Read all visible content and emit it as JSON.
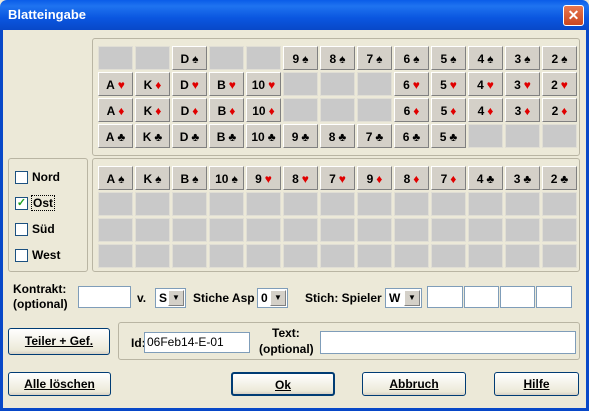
{
  "window": {
    "title": "Blatteingabe",
    "close": "✕"
  },
  "top_grid": [
    [
      null,
      null,
      {
        "r": "D",
        "s": "♠",
        "c": "black"
      },
      null,
      null,
      {
        "r": "9",
        "s": "♠",
        "c": "black"
      },
      {
        "r": "8",
        "s": "♠",
        "c": "black"
      },
      {
        "r": "7",
        "s": "♠",
        "c": "black"
      },
      {
        "r": "6",
        "s": "♠",
        "c": "black"
      },
      {
        "r": "5",
        "s": "♠",
        "c": "black"
      },
      {
        "r": "4",
        "s": "♠",
        "c": "black"
      },
      {
        "r": "3",
        "s": "♠",
        "c": "black"
      },
      {
        "r": "2",
        "s": "♠",
        "c": "black"
      }
    ],
    [
      {
        "r": "A",
        "s": "♥",
        "c": "red"
      },
      {
        "r": "K",
        "s": "♦",
        "c": "red"
      },
      {
        "r": "D",
        "s": "♥",
        "c": "red"
      },
      {
        "r": "B",
        "s": "♥",
        "c": "red"
      },
      {
        "r": "10",
        "s": "♥",
        "c": "red"
      },
      null,
      null,
      null,
      {
        "r": "6",
        "s": "♥",
        "c": "red"
      },
      {
        "r": "5",
        "s": "♥",
        "c": "red"
      },
      {
        "r": "4",
        "s": "♥",
        "c": "red"
      },
      {
        "r": "3",
        "s": "♥",
        "c": "red"
      },
      {
        "r": "2",
        "s": "♥",
        "c": "red"
      }
    ],
    [
      {
        "r": "A",
        "s": "♦",
        "c": "red"
      },
      {
        "r": "K",
        "s": "♦",
        "c": "red"
      },
      {
        "r": "D",
        "s": "♦",
        "c": "red"
      },
      {
        "r": "B",
        "s": "♦",
        "c": "red"
      },
      {
        "r": "10",
        "s": "♦",
        "c": "red"
      },
      null,
      null,
      null,
      {
        "r": "6",
        "s": "♦",
        "c": "red"
      },
      {
        "r": "5",
        "s": "♦",
        "c": "red"
      },
      {
        "r": "4",
        "s": "♦",
        "c": "red"
      },
      {
        "r": "3",
        "s": "♦",
        "c": "red"
      },
      {
        "r": "2",
        "s": "♦",
        "c": "red"
      }
    ],
    [
      {
        "r": "A",
        "s": "♣",
        "c": "black"
      },
      {
        "r": "K",
        "s": "♣",
        "c": "black"
      },
      {
        "r": "D",
        "s": "♣",
        "c": "black"
      },
      {
        "r": "B",
        "s": "♣",
        "c": "black"
      },
      {
        "r": "10",
        "s": "♣",
        "c": "black"
      },
      {
        "r": "9",
        "s": "♣",
        "c": "black"
      },
      {
        "r": "8",
        "s": "♣",
        "c": "black"
      },
      {
        "r": "7",
        "s": "♣",
        "c": "black"
      },
      {
        "r": "6",
        "s": "♣",
        "c": "black"
      },
      {
        "r": "5",
        "s": "♣",
        "c": "black"
      },
      null,
      null,
      null
    ]
  ],
  "bottom_grid": [
    [
      {
        "r": "A",
        "s": "♠",
        "c": "black"
      },
      {
        "r": "K",
        "s": "♠",
        "c": "black"
      },
      {
        "r": "B",
        "s": "♠",
        "c": "black"
      },
      {
        "r": "10",
        "s": "♠",
        "c": "black"
      },
      {
        "r": "9",
        "s": "♥",
        "c": "red"
      },
      {
        "r": "8",
        "s": "♥",
        "c": "red"
      },
      {
        "r": "7",
        "s": "♥",
        "c": "red"
      },
      {
        "r": "9",
        "s": "♦",
        "c": "red"
      },
      {
        "r": "8",
        "s": "♦",
        "c": "red"
      },
      {
        "r": "7",
        "s": "♦",
        "c": "red"
      },
      {
        "r": "4",
        "s": "♣",
        "c": "black"
      },
      {
        "r": "3",
        "s": "♣",
        "c": "black"
      },
      {
        "r": "2",
        "s": "♣",
        "c": "black"
      }
    ],
    [
      null,
      null,
      null,
      null,
      null,
      null,
      null,
      null,
      null,
      null,
      null,
      null,
      null
    ],
    [
      null,
      null,
      null,
      null,
      null,
      null,
      null,
      null,
      null,
      null,
      null,
      null,
      null
    ],
    [
      null,
      null,
      null,
      null,
      null,
      null,
      null,
      null,
      null,
      null,
      null,
      null,
      null
    ]
  ],
  "players": [
    {
      "label": "Nord",
      "checked": false
    },
    {
      "label": "Ost",
      "checked": true
    },
    {
      "label": "Süd",
      "checked": false
    },
    {
      "label": "West",
      "checked": false
    }
  ],
  "contract": {
    "label1": "Kontrakt:",
    "label2": "(optional)",
    "value": "",
    "v_label": "v.",
    "v_value": "S",
    "stiche_label": "Stiche Asp",
    "stiche_value": "0",
    "stich_label": "Stich: Spieler",
    "stich_value": "W",
    "extra_fields": [
      "",
      "",
      "",
      ""
    ]
  },
  "teiler_button": "Teiler + Gef.",
  "id_label": "Id:",
  "id_value": "06Feb14-E-01",
  "text_label1": "Text:",
  "text_label2": "(optional)",
  "text_value": "",
  "buttons": {
    "clear": "Alle löschen",
    "ok": "Ok",
    "cancel": "Abbruch",
    "help": "Hilfe"
  },
  "colors": {
    "red_suit": "#e00000",
    "title_bar": "#0a5ce8"
  }
}
